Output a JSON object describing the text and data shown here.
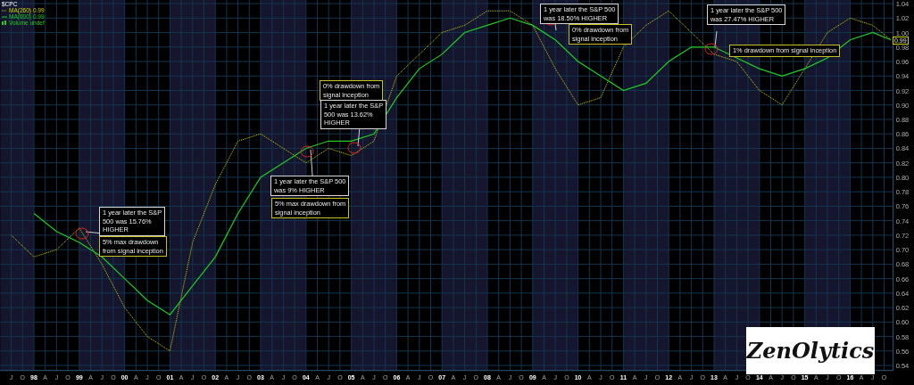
{
  "legend": [
    {
      "kind": "symbol",
      "label": "$CPC"
    },
    {
      "kind": "volume",
      "label": "Volume undef",
      "color": "#22cc22"
    }
  ],
  "legend_values": [
    "0.99",
    "0.99"
  ],
  "chart_data": {
    "type": "line",
    "grid": true,
    "x": [
      1997.5,
      1998,
      1998.5,
      1999,
      1999.5,
      2000,
      2000.5,
      2001,
      2001.5,
      2002,
      2002.5,
      2003,
      2003.5,
      2004,
      2004.5,
      2005,
      2005.5,
      2006,
      2006.5,
      2007,
      2007.5,
      2008,
      2008.5,
      2009,
      2009.5,
      2010,
      2010.5,
      2011,
      2011.5,
      2012,
      2012.5,
      2013,
      2013.5,
      2014,
      2014.5,
      2015,
      2015.5,
      2016,
      2016.5,
      2016.9
    ],
    "series": [
      {
        "name": "MA(260)",
        "color": "#d4d400",
        "line_style": "dotted",
        "values": [
          0.72,
          0.69,
          0.7,
          0.73,
          0.68,
          0.62,
          0.58,
          0.56,
          0.71,
          0.79,
          0.85,
          0.86,
          0.84,
          0.82,
          0.84,
          0.83,
          0.85,
          0.94,
          0.97,
          1.0,
          1.01,
          1.03,
          1.03,
          1.01,
          0.95,
          0.9,
          0.91,
          0.98,
          1.01,
          1.03,
          1.0,
          0.97,
          0.96,
          0.92,
          0.9,
          0.95,
          1.0,
          1.02,
          1.01,
          0.99
        ]
      },
      {
        "name": "MA(600)",
        "color": "#22cc22",
        "line_style": "solid",
        "values": [
          null,
          0.75,
          0.725,
          0.71,
          0.69,
          0.66,
          0.63,
          0.61,
          0.65,
          0.69,
          0.75,
          0.8,
          0.82,
          0.84,
          0.85,
          0.85,
          0.86,
          0.91,
          0.95,
          0.97,
          1.0,
          1.01,
          1.02,
          1.01,
          0.99,
          0.96,
          0.94,
          0.92,
          0.93,
          0.96,
          0.98,
          0.98,
          0.965,
          0.95,
          0.94,
          0.95,
          0.965,
          0.99,
          1.0,
          0.99
        ]
      }
    ],
    "xlim": [
      1997.26,
      2016.95
    ],
    "ylim": [
      0.533,
      1.045
    ],
    "xticks": [
      {
        "value": 1997.5,
        "label": "J"
      },
      {
        "value": 1997.75,
        "label": "O"
      },
      {
        "value": 1998,
        "label": "98"
      },
      {
        "value": 1998.25,
        "label": "A"
      },
      {
        "value": 1998.5,
        "label": "J"
      },
      {
        "value": 1998.75,
        "label": "O"
      },
      {
        "value": 1999,
        "label": "99"
      },
      {
        "value": 1999.25,
        "label": "A"
      },
      {
        "value": 1999.5,
        "label": "J"
      },
      {
        "value": 1999.75,
        "label": "O"
      },
      {
        "value": 2000,
        "label": "00"
      },
      {
        "value": 2000.25,
        "label": "A"
      },
      {
        "value": 2000.5,
        "label": "J"
      },
      {
        "value": 2000.75,
        "label": "O"
      },
      {
        "value": 2001,
        "label": "01"
      },
      {
        "value": 2001.25,
        "label": "A"
      },
      {
        "value": 2001.5,
        "label": "J"
      },
      {
        "value": 2001.75,
        "label": "O"
      },
      {
        "value": 2002,
        "label": "02"
      },
      {
        "value": 2002.25,
        "label": "A"
      },
      {
        "value": 2002.5,
        "label": "J"
      },
      {
        "value": 2002.75,
        "label": "O"
      },
      {
        "value": 2003,
        "label": "03"
      },
      {
        "value": 2003.25,
        "label": "A"
      },
      {
        "value": 2003.5,
        "label": "J"
      },
      {
        "value": 2003.75,
        "label": "O"
      },
      {
        "value": 2004,
        "label": "04"
      },
      {
        "value": 2004.25,
        "label": "A"
      },
      {
        "value": 2004.5,
        "label": "J"
      },
      {
        "value": 2004.75,
        "label": "O"
      },
      {
        "value": 2005,
        "label": "05"
      },
      {
        "value": 2005.25,
        "label": "A"
      },
      {
        "value": 2005.5,
        "label": "J"
      },
      {
        "value": 2005.75,
        "label": "O"
      },
      {
        "value": 2006,
        "label": "06"
      },
      {
        "value": 2006.25,
        "label": "A"
      },
      {
        "value": 2006.5,
        "label": "J"
      },
      {
        "value": 2006.75,
        "label": "O"
      },
      {
        "value": 2007,
        "label": "07"
      },
      {
        "value": 2007.25,
        "label": "A"
      },
      {
        "value": 2007.5,
        "label": "J"
      },
      {
        "value": 2007.75,
        "label": "O"
      },
      {
        "value": 2008,
        "label": "08"
      },
      {
        "value": 2008.25,
        "label": "A"
      },
      {
        "value": 2008.5,
        "label": "J"
      },
      {
        "value": 2008.75,
        "label": "O"
      },
      {
        "value": 2009,
        "label": "09"
      },
      {
        "value": 2009.25,
        "label": "A"
      },
      {
        "value": 2009.5,
        "label": "J"
      },
      {
        "value": 2009.75,
        "label": "O"
      },
      {
        "value": 2010,
        "label": "10"
      },
      {
        "value": 2010.25,
        "label": "A"
      },
      {
        "value": 2010.5,
        "label": "J"
      },
      {
        "value": 2010.75,
        "label": "O"
      },
      {
        "value": 2011,
        "label": "11"
      },
      {
        "value": 2011.25,
        "label": "A"
      },
      {
        "value": 2011.5,
        "label": "J"
      },
      {
        "value": 2011.75,
        "label": "O"
      },
      {
        "value": 2012,
        "label": "12"
      },
      {
        "value": 2012.25,
        "label": "A"
      },
      {
        "value": 2012.5,
        "label": "J"
      },
      {
        "value": 2012.75,
        "label": "O"
      },
      {
        "value": 2013,
        "label": "13"
      },
      {
        "value": 2013.25,
        "label": "A"
      },
      {
        "value": 2013.5,
        "label": "J"
      },
      {
        "value": 2013.75,
        "label": "O"
      },
      {
        "value": 2014,
        "label": "14"
      },
      {
        "value": 2014.25,
        "label": "A"
      },
      {
        "value": 2014.5,
        "label": "J"
      },
      {
        "value": 2014.75,
        "label": "O"
      },
      {
        "value": 2015,
        "label": "15"
      },
      {
        "value": 2015.25,
        "label": "A"
      },
      {
        "value": 2015.5,
        "label": "J"
      },
      {
        "value": 2015.75,
        "label": "O"
      },
      {
        "value": 2016,
        "label": "16"
      },
      {
        "value": 2016.25,
        "label": "A"
      },
      {
        "value": 2016.5,
        "label": "J"
      },
      {
        "value": 2016.75,
        "label": "O"
      }
    ],
    "yticks": [
      {
        "value": 0.54,
        "label": "0.54"
      },
      {
        "value": 0.56,
        "label": "0.56"
      },
      {
        "value": 0.58,
        "label": "0.58"
      },
      {
        "value": 0.6,
        "label": "0.60"
      },
      {
        "value": 0.62,
        "label": "0.62"
      },
      {
        "value": 0.64,
        "label": "0.64"
      },
      {
        "value": 0.66,
        "label": "0.66"
      },
      {
        "value": 0.68,
        "label": "0.68"
      },
      {
        "value": 0.7,
        "label": "0.70"
      },
      {
        "value": 0.72,
        "label": "0.72"
      },
      {
        "value": 0.74,
        "label": "0.74"
      },
      {
        "value": 0.76,
        "label": "0.76"
      },
      {
        "value": 0.78,
        "label": "0.78"
      },
      {
        "value": 0.8,
        "label": "0.80"
      },
      {
        "value": 0.82,
        "label": "0.82"
      },
      {
        "value": 0.84,
        "label": "0.84"
      },
      {
        "value": 0.86,
        "label": "0.86"
      },
      {
        "value": 0.88,
        "label": "0.88"
      },
      {
        "value": 0.9,
        "label": "0.90"
      },
      {
        "value": 0.92,
        "label": "0.92"
      },
      {
        "value": 0.94,
        "label": "0.94"
      },
      {
        "value": 0.96,
        "label": "0.96"
      },
      {
        "value": 0.98,
        "label": "0.98"
      },
      {
        "value": 1.0,
        "label": "1.00"
      },
      {
        "value": 1.02,
        "label": "1.02"
      },
      {
        "value": 1.04,
        "label": "1.04"
      }
    ]
  },
  "callouts": [
    {
      "kind": "result",
      "lines": [
        "1 year later the S&P",
        "500 was 15.76%",
        "HIGHER"
      ]
    },
    {
      "kind": "drawdown",
      "lines": [
        "5% max drawdown",
        "from signal inception"
      ]
    },
    {
      "kind": "result",
      "lines": [
        "1 year later the S&P 500",
        "was 9% HIGHER"
      ]
    },
    {
      "kind": "drawdown",
      "lines": [
        "5% max drawdown from",
        "signal inception"
      ]
    },
    {
      "kind": "drawdown",
      "lines": [
        "0% drawdown from",
        "signal inception"
      ]
    },
    {
      "kind": "result",
      "lines": [
        "1 year later the S&P",
        "500 was 13.62%",
        "HIGHER"
      ]
    },
    {
      "kind": "result",
      "lines": [
        "1 year later the S&P 500",
        "was 18.50% HIGHER"
      ]
    },
    {
      "kind": "drawdown",
      "lines": [
        "0% drawdown from",
        "signal inception"
      ]
    },
    {
      "kind": "result",
      "lines": [
        "1 year later the S&P 500",
        "was 27.47% HIGHER"
      ]
    },
    {
      "kind": "drawdown",
      "lines": [
        "1% drawdown from signal inception"
      ]
    }
  ],
  "last_value": "0.99",
  "logo": "ZenOlytics"
}
